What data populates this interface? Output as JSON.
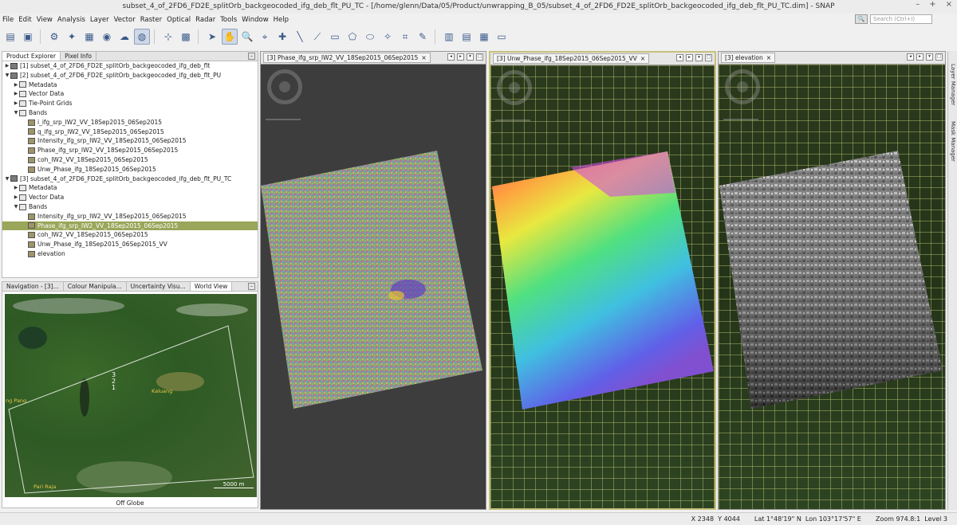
{
  "window": {
    "title": "subset_4_of_2FD6_FD2E_splitOrb_backgeocoded_ifg_deb_flt_PU_TC - [/home/glenn/Data/05/Product/unwrapping_B_05/subset_4_of_2FD6_FD2E_splitOrb_backgeocoded_ifg_deb_flt_PU_TC.dim] - SNAP",
    "minimize": "–",
    "maximize": "+",
    "close": "×"
  },
  "menu": [
    "File",
    "Edit",
    "View",
    "Analysis",
    "Layer",
    "Vector",
    "Raster",
    "Optical",
    "Radar",
    "Tools",
    "Window",
    "Help"
  ],
  "search": {
    "placeholder": "Search (Ctrl+I)"
  },
  "left_tabs": [
    "Product Explorer",
    "Pixel Info"
  ],
  "tree": [
    {
      "label": "[1] subset_4_of_2FD6_FD2E_splitOrb_backgeocoded_ifg_deb_flt",
      "level": 0,
      "arrow": "▶",
      "icon": "prod"
    },
    {
      "label": "[2] subset_4_of_2FD6_FD2E_splitOrb_backgeocoded_ifg_deb_flt_PU",
      "level": 0,
      "arrow": "▼",
      "icon": "prod"
    },
    {
      "label": "Metadata",
      "level": 1,
      "arrow": "▶",
      "icon": "fold"
    },
    {
      "label": "Vector Data",
      "level": 1,
      "arrow": "▶",
      "icon": "fold"
    },
    {
      "label": "Tie-Point Grids",
      "level": 1,
      "arrow": "▶",
      "icon": "fold"
    },
    {
      "label": "Bands",
      "level": 1,
      "arrow": "▼",
      "icon": "fold"
    },
    {
      "label": "i_ifg_srp_IW2_VV_18Sep2015_06Sep2015",
      "level": 2,
      "arrow": "",
      "icon": "band"
    },
    {
      "label": "q_ifg_srp_IW2_VV_18Sep2015_06Sep2015",
      "level": 2,
      "arrow": "",
      "icon": "band"
    },
    {
      "label": "Intensity_ifg_srp_IW2_VV_18Sep2015_06Sep2015",
      "level": 2,
      "arrow": "",
      "icon": "band"
    },
    {
      "label": "Phase_ifg_srp_IW2_VV_18Sep2015_06Sep2015",
      "level": 2,
      "arrow": "",
      "icon": "band"
    },
    {
      "label": "coh_IW2_VV_18Sep2015_06Sep2015",
      "level": 2,
      "arrow": "",
      "icon": "band"
    },
    {
      "label": "Unw_Phase_ifg_18Sep2015_06Sep2015",
      "level": 2,
      "arrow": "",
      "icon": "band"
    },
    {
      "label": "[3] subset_4_of_2FD6_FD2E_splitOrb_backgeocoded_ifg_deb_flt_PU_TC",
      "level": 0,
      "arrow": "▼",
      "icon": "prod"
    },
    {
      "label": "Metadata",
      "level": 1,
      "arrow": "▶",
      "icon": "fold"
    },
    {
      "label": "Vector Data",
      "level": 1,
      "arrow": "▶",
      "icon": "fold"
    },
    {
      "label": "Bands",
      "level": 1,
      "arrow": "▼",
      "icon": "fold"
    },
    {
      "label": "Intensity_ifg_srp_IW2_VV_18Sep2015_06Sep2015",
      "level": 2,
      "arrow": "",
      "icon": "band"
    },
    {
      "label": "Phase_ifg_srp_IW2_VV_18Sep2015_06Sep2015",
      "level": 2,
      "arrow": "",
      "icon": "band",
      "selected": true
    },
    {
      "label": "coh_IW2_VV_18Sep2015_06Sep2015",
      "level": 2,
      "arrow": "",
      "icon": "band"
    },
    {
      "label": "Unw_Phase_ifg_18Sep2015_06Sep2015_VV",
      "level": 2,
      "arrow": "",
      "icon": "band"
    },
    {
      "label": "elevation",
      "level": 2,
      "arrow": "",
      "icon": "band"
    }
  ],
  "nav_tabs": [
    "Navigation - [3]...",
    "Colour Manipula...",
    "Uncertainty Visu...",
    "World View"
  ],
  "worldview": {
    "labels": [
      "3",
      "2",
      "1"
    ],
    "places": [
      "Kaluang",
      "ng Pang",
      "Pari Raja"
    ],
    "scale": "5000 m",
    "footer": "Off Globe"
  },
  "views": [
    {
      "title": "[3] Phase_ifg_srp_IW2_VV_18Sep2015_06Sep2015"
    },
    {
      "title": "[3] Unw_Phase_ifg_18Sep2015_06Sep2015_VV"
    },
    {
      "title": "[3] elevation"
    }
  ],
  "view_buttons": [
    "◂",
    "▸",
    "▾",
    "□"
  ],
  "side_tools": [
    "Layer Manager",
    "Mask Manager"
  ],
  "status": {
    "x_label": "X",
    "x": "2348",
    "y_label": "Y",
    "y": "4044",
    "lat": "Lat 1°48'19\" N",
    "lon": "Lon 103°17'57\" E",
    "zoom": "Zoom 974.8:1",
    "level": "Level 3"
  }
}
